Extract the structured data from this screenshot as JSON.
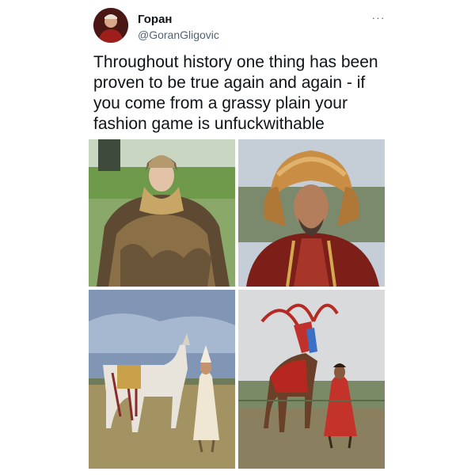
{
  "tweet": {
    "author": {
      "display_name": "Горан",
      "handle": "@GoranGligovic",
      "avatar_icon": "user-avatar"
    },
    "more_icon": "more-dots-icon",
    "more_label": "···",
    "text": "Throughout history one thing has been proven to be true again and again - if you come from a grassy plain your fashion game is unfuckwithable",
    "media": [
      {
        "slot": 1,
        "icon": "photo-woman-fur-cloak"
      },
      {
        "slot": 2,
        "icon": "photo-man-fur-hat"
      },
      {
        "slot": 3,
        "icon": "photo-woman-white-horse"
      },
      {
        "slot": 4,
        "icon": "photo-woman-red-horse"
      }
    ]
  },
  "colors": {
    "text": "#0f1419",
    "secondary": "#536471",
    "background": "#ffffff"
  }
}
